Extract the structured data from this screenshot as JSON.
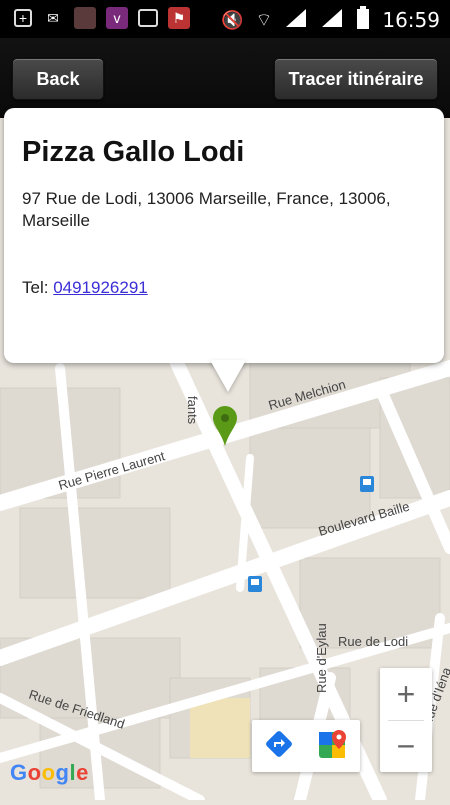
{
  "status_bar": {
    "time": "16:59",
    "icons": [
      "add-icon",
      "gmail-icon",
      "app-icon",
      "vine-icon",
      "gallery-icon",
      "flag-icon",
      "mute-icon",
      "wifi-icon",
      "signal-icon",
      "signal-icon",
      "battery-icon"
    ]
  },
  "action_bar": {
    "back_label": "Back",
    "route_label": "Tracer itinéraire"
  },
  "info_window": {
    "title": "Pizza Gallo Lodi",
    "address": "97 Rue de Lodi, 13006 Marseille, France, 13006, Marseille",
    "tel_label": "Tel:",
    "tel_number": "0491926291"
  },
  "map": {
    "streets": {
      "enfants": "fants",
      "melchion": "Rue Melchion",
      "pierre_laurent": "Rue Pierre Laurent",
      "boulevard_baille": "Boulevard Baille",
      "lodi": "Rue de Lodi",
      "friedland": "Rue de Friedland",
      "eylau": "Rue d'Eylau",
      "iena": "Rue d'Iéna"
    },
    "marker_color": "#5a9a17",
    "zoom_in": "+",
    "zoom_out": "−",
    "attribution": "Google"
  }
}
